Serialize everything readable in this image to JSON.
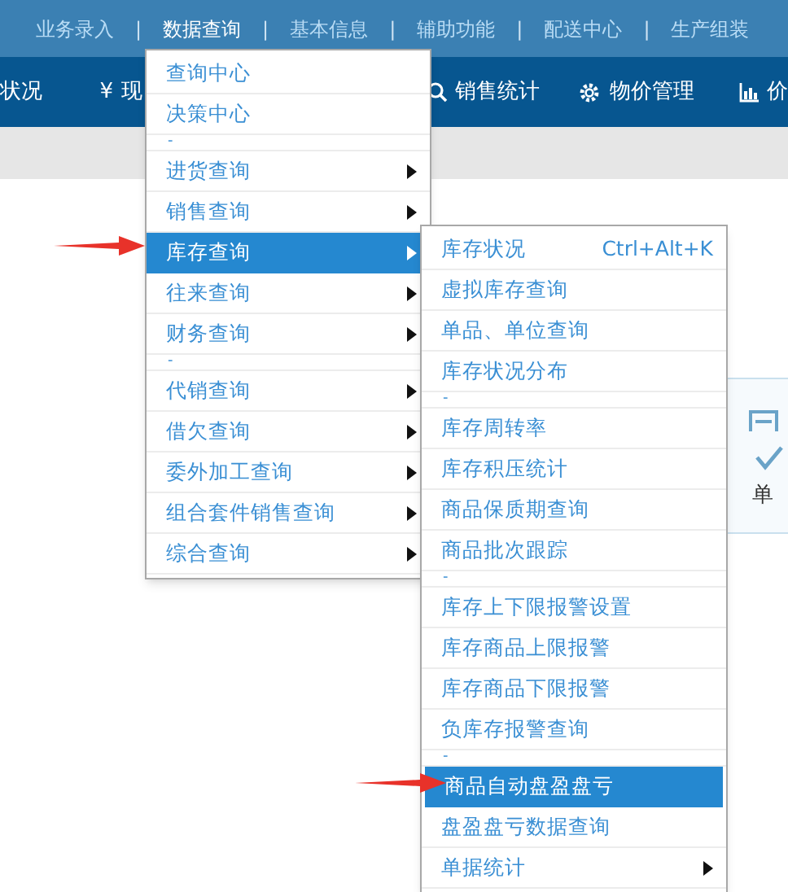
{
  "top_nav": {
    "items": [
      {
        "label": "业务录入",
        "selected": false
      },
      {
        "label": "数据查询",
        "selected": true
      },
      {
        "label": "基本信息",
        "selected": false
      },
      {
        "label": "辅助功能",
        "selected": false
      },
      {
        "label": "配送中心",
        "selected": false
      },
      {
        "label": "生产组装",
        "selected": false
      }
    ],
    "dividers": [
      "|",
      "|",
      "|",
      "|",
      "|"
    ]
  },
  "toolbar": [
    {
      "kind": "plain",
      "label": "状况"
    },
    {
      "kind": "currency",
      "symbol": "¥",
      "label": "现"
    },
    {
      "kind": "search",
      "label": "销售统计"
    },
    {
      "kind": "gear",
      "label": "物价管理"
    },
    {
      "kind": "chart",
      "label": "价"
    }
  ],
  "card": {
    "label": "单"
  },
  "menu": [
    {
      "kind": "item",
      "label": "查询中心",
      "selected": false,
      "submenu": false
    },
    {
      "kind": "item",
      "label": "决策中心",
      "selected": false,
      "submenu": false
    },
    {
      "kind": "separator",
      "label": "-"
    },
    {
      "kind": "item",
      "label": "进货查询",
      "selected": false,
      "submenu": true
    },
    {
      "kind": "item",
      "label": "销售查询",
      "selected": false,
      "submenu": true
    },
    {
      "kind": "item",
      "label": "库存查询",
      "selected": true,
      "submenu": true
    },
    {
      "kind": "item",
      "label": "往来查询",
      "selected": false,
      "submenu": true
    },
    {
      "kind": "item",
      "label": "财务查询",
      "selected": false,
      "submenu": true
    },
    {
      "kind": "separator",
      "label": "-"
    },
    {
      "kind": "item",
      "label": "代销查询",
      "selected": false,
      "submenu": true
    },
    {
      "kind": "item",
      "label": "借欠查询",
      "selected": false,
      "submenu": true
    },
    {
      "kind": "item",
      "label": "委外加工查询",
      "selected": false,
      "submenu": true
    },
    {
      "kind": "item",
      "label": "组合套件销售查询",
      "selected": false,
      "submenu": true
    },
    {
      "kind": "item",
      "label": "综合查询",
      "selected": false,
      "submenu": true
    }
  ],
  "submenu": [
    {
      "kind": "item",
      "label": "库存状况",
      "shortcut": "Ctrl+Alt+K",
      "selected": false,
      "submenu": false
    },
    {
      "kind": "item",
      "label": "虚拟库存查询",
      "selected": false,
      "submenu": false
    },
    {
      "kind": "item",
      "label": "单品、单位查询",
      "selected": false,
      "submenu": false
    },
    {
      "kind": "item",
      "label": "库存状况分布",
      "selected": false,
      "submenu": false
    },
    {
      "kind": "separator",
      "label": "-"
    },
    {
      "kind": "item",
      "label": "库存周转率",
      "selected": false,
      "submenu": false
    },
    {
      "kind": "item",
      "label": "库存积压统计",
      "selected": false,
      "submenu": false
    },
    {
      "kind": "item",
      "label": "商品保质期查询",
      "selected": false,
      "submenu": false
    },
    {
      "kind": "item",
      "label": "商品批次跟踪",
      "selected": false,
      "submenu": false
    },
    {
      "kind": "separator",
      "label": "-"
    },
    {
      "kind": "item",
      "label": "库存上下限报警设置",
      "selected": false,
      "submenu": false
    },
    {
      "kind": "item",
      "label": "库存商品上限报警",
      "selected": false,
      "submenu": false
    },
    {
      "kind": "item",
      "label": "库存商品下限报警",
      "selected": false,
      "submenu": false
    },
    {
      "kind": "item",
      "label": "负库存报警查询",
      "selected": false,
      "submenu": false
    },
    {
      "kind": "separator",
      "label": "-"
    },
    {
      "kind": "item",
      "label": "商品自动盘盈盘亏",
      "selected": true,
      "submenu": false
    },
    {
      "kind": "item",
      "label": "盘盈盘亏数据查询",
      "selected": false,
      "submenu": false
    },
    {
      "kind": "item",
      "label": "单据统计",
      "selected": false,
      "submenu": true
    }
  ]
}
